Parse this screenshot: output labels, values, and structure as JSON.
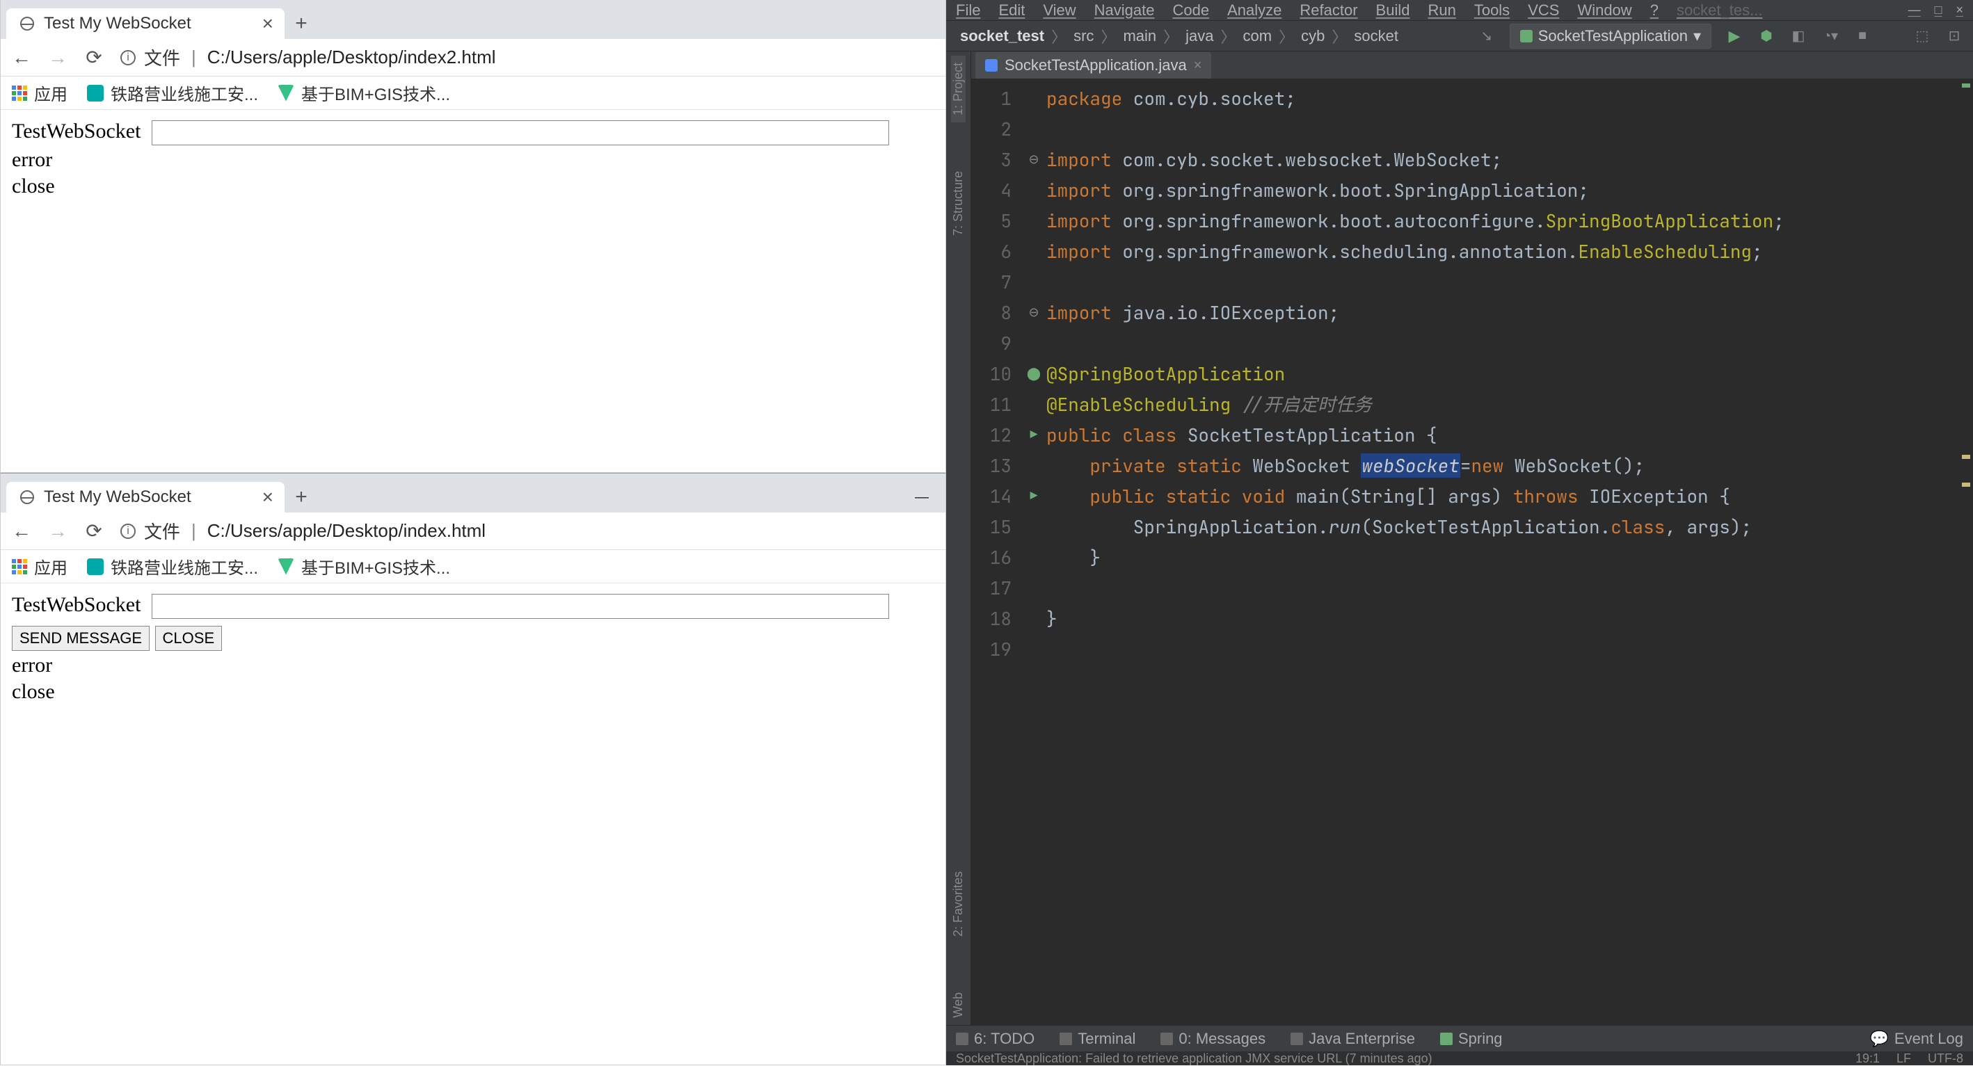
{
  "browser1": {
    "tab_title": "Test My WebSocket",
    "url_prefix": "文件",
    "url": "C:/Users/apple/Desktop/index2.html",
    "apps_label": "应用",
    "bookmark1": "铁路营业线施工安...",
    "bookmark2": "基于BIM+GIS技术...",
    "heading": "TestWebSocket",
    "line1": "error",
    "line2": "close"
  },
  "browser2": {
    "tab_title": "Test My WebSocket",
    "url_prefix": "文件",
    "url": "C:/Users/apple/Desktop/index.html",
    "apps_label": "应用",
    "bookmark1": "铁路营业线施工安...",
    "bookmark2": "基于BIM+GIS技术...",
    "heading": "TestWebSocket",
    "btn_send": "SEND MESSAGE",
    "btn_close": "CLOSE",
    "line1": "error",
    "line2": "close",
    "win_min": "—"
  },
  "ide": {
    "menu": [
      "File",
      "Edit",
      "View",
      "Navigate",
      "Code",
      "Analyze",
      "Refactor",
      "Build",
      "Run",
      "Tools",
      "VCS",
      "Window",
      "?"
    ],
    "menu_right": "socket_tes...",
    "crumbs": [
      "socket_test",
      "src",
      "main",
      "java",
      "com",
      "cyb",
      "socket"
    ],
    "run_config": "SocketTestApplication",
    "editor_tab": "SocketTestApplication.java",
    "gutter": {
      "project": "1: Project",
      "structure": "7: Structure",
      "favorites": "2: Favorites",
      "web": "Web"
    },
    "code_lines": [
      "package com.cyb.socket;",
      "",
      "import com.cyb.socket.websocket.WebSocket;",
      "import org.springframework.boot.SpringApplication;",
      "import org.springframework.boot.autoconfigure.SpringBootApplication;",
      "import org.springframework.scheduling.annotation.EnableScheduling;",
      "",
      "import java.io.IOException;",
      "",
      "@SpringBootApplication",
      "@EnableScheduling //开启定时任务",
      "public class SocketTestApplication {",
      "    private static WebSocket webSocket=new WebSocket();",
      "    public static void main(String[] args) throws IOException {",
      "        SpringApplication.run(SocketTestApplication.class, args);",
      "    }",
      "",
      "}",
      ""
    ],
    "bottom": {
      "todo": "6: TODO",
      "terminal": "Terminal",
      "messages": "0: Messages",
      "java_ee": "Java Enterprise",
      "spring": "Spring",
      "event_log": "Event Log"
    },
    "status_left": "SocketTestApplication: Failed to retrieve application JMX service URL (7 minutes ago)",
    "status_right": [
      "19:1",
      "LF",
      "UTF-8"
    ]
  }
}
